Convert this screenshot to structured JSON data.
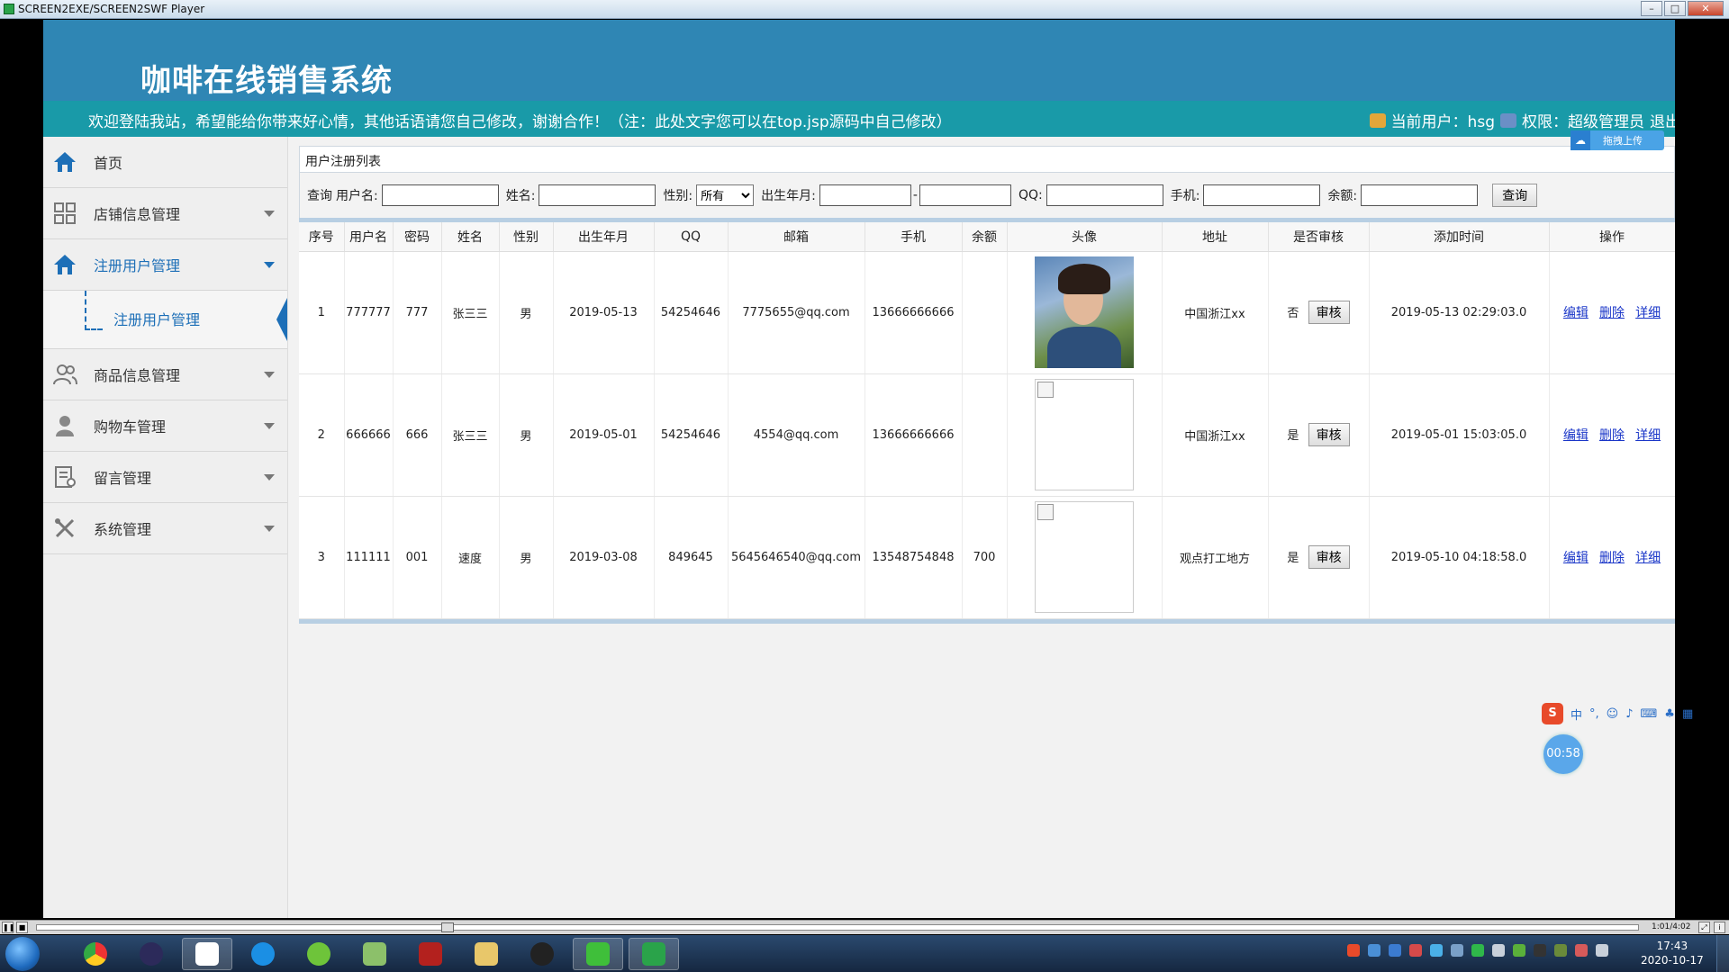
{
  "player": {
    "title": "SCREEN2EXE/SCREEN2SWF Player",
    "time": "1:01/4:02"
  },
  "header": {
    "title": "咖啡在线销售系统",
    "welcome": "欢迎登陆我站，希望能给你带来好心情，其他话语请您自己修改，谢谢合作！（注：此处文字您可以在top.jsp源码中自己修改）",
    "current_user": "当前用户：hsg",
    "permission": "权限：超级管理员",
    "logout": "退出"
  },
  "sidebar": {
    "items": [
      {
        "label": "首页",
        "icon": "home-icon"
      },
      {
        "label": "店铺信息管理",
        "icon": "grid-icon"
      },
      {
        "label": "注册用户管理",
        "icon": "home-icon"
      },
      {
        "label": "商品信息管理",
        "icon": "users-icon"
      },
      {
        "label": "购物车管理",
        "icon": "user-icon"
      },
      {
        "label": "留言管理",
        "icon": "note-icon"
      },
      {
        "label": "系统管理",
        "icon": "tools-icon"
      }
    ],
    "sub_item": "注册用户管理"
  },
  "main": {
    "breadcrumb": "用户注册列表",
    "search": {
      "prefix": "查询",
      "username_label": "用户名:",
      "name_label": "姓名:",
      "gender_label": "性别:",
      "gender_value": "所有",
      "birth_label": "出生年月:",
      "qq_label": "QQ:",
      "phone_label": "手机:",
      "balance_label": "余额:",
      "query_button": "查询"
    },
    "columns": [
      "序号",
      "用户名",
      "密码",
      "姓名",
      "性别",
      "出生年月",
      "QQ",
      "邮箱",
      "手机",
      "余额",
      "头像",
      "地址",
      "是否审核",
      "添加时间",
      "操作"
    ],
    "rows": [
      {
        "idx": "1",
        "username": "777777",
        "password": "777",
        "name": "张三三",
        "gender": "男",
        "birth": "2019-05-13",
        "qq": "54254646",
        "email": "7775655@qq.com",
        "phone": "13666666666",
        "balance": "",
        "address": "中国浙江xx",
        "audited": "否",
        "audit_btn": "审核",
        "added": "2019-05-13 02:29:03.0",
        "edit": "编辑",
        "delete": "删除",
        "detail": "详细"
      },
      {
        "idx": "2",
        "username": "666666",
        "password": "666",
        "name": "张三三",
        "gender": "男",
        "birth": "2019-05-01",
        "qq": "54254646",
        "email": "4554@qq.com",
        "phone": "13666666666",
        "balance": "",
        "address": "中国浙江xx",
        "audited": "是",
        "audit_btn": "审核",
        "added": "2019-05-01 15:03:05.0",
        "edit": "编辑",
        "delete": "删除",
        "detail": "详细"
      },
      {
        "idx": "3",
        "username": "111111",
        "password": "001",
        "name": "速度",
        "gender": "男",
        "birth": "2019-03-08",
        "qq": "849645",
        "email": "5645646540@qq.com",
        "phone": "13548754848",
        "balance": "700",
        "address": "观点打工地方",
        "audited": "是",
        "audit_btn": "审核",
        "added": "2019-05-10 04:18:58.0",
        "edit": "编辑",
        "delete": "删除",
        "detail": "详细"
      }
    ]
  },
  "widgets": {
    "upload": "拖拽上传",
    "timer": "00:58",
    "ime": "中"
  },
  "taskbar": {
    "time": "17:43",
    "date": "2020-10-17"
  }
}
